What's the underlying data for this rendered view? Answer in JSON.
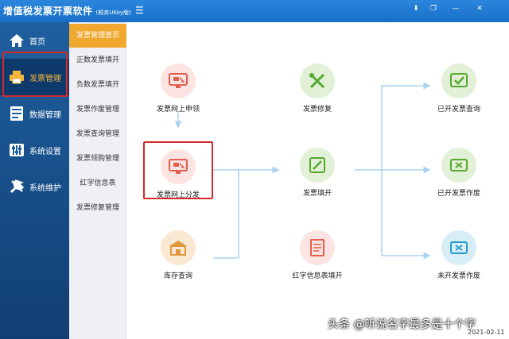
{
  "app": {
    "title": "增值税发票开票软件",
    "subtitle": "(税务UKey版)"
  },
  "window_buttons": [
    "download-icon",
    "restore-icon",
    "minimize-icon",
    "close-icon"
  ],
  "sidebar": {
    "items": [
      {
        "label": "首页",
        "icon": "home-icon"
      },
      {
        "label": "发票管理",
        "icon": "printer-icon",
        "active": true
      },
      {
        "label": "数据管理",
        "icon": "database-icon"
      },
      {
        "label": "系统设置",
        "icon": "sliders-icon"
      },
      {
        "label": "系统维护",
        "icon": "wrench-icon"
      }
    ]
  },
  "submenu": {
    "items": [
      {
        "label": "发票管理首页",
        "active": true
      },
      {
        "label": "正数发票填开"
      },
      {
        "label": "负数发票填开"
      },
      {
        "label": "发票作废管理"
      },
      {
        "label": "发票查询管理"
      },
      {
        "label": "发票领购管理"
      },
      {
        "label": "红字信息表"
      },
      {
        "label": "发票修复管理"
      }
    ]
  },
  "flow": {
    "apply": {
      "label": "发票网上申领",
      "color": "#e25f50"
    },
    "distribute": {
      "label": "发票网上分发",
      "color": "#e25f50"
    },
    "inventory": {
      "label": "库存查询",
      "color": "#e0973c"
    },
    "repair": {
      "label": "发票修复",
      "color": "#56a82e"
    },
    "issue": {
      "label": "发票填开",
      "color": "#56a82e"
    },
    "redinfo": {
      "label": "红字信息表填开",
      "color": "#e25f50"
    },
    "query_issued": {
      "label": "已开发票查询",
      "color": "#56a82e"
    },
    "void_issued": {
      "label": "已开发票作废",
      "color": "#56a82e"
    },
    "void_unissued": {
      "label": "未开发票作废",
      "color": "#2a9ccc"
    }
  },
  "watermark": "头条 @听说名字最多是十个字",
  "date": "2021-02-11"
}
